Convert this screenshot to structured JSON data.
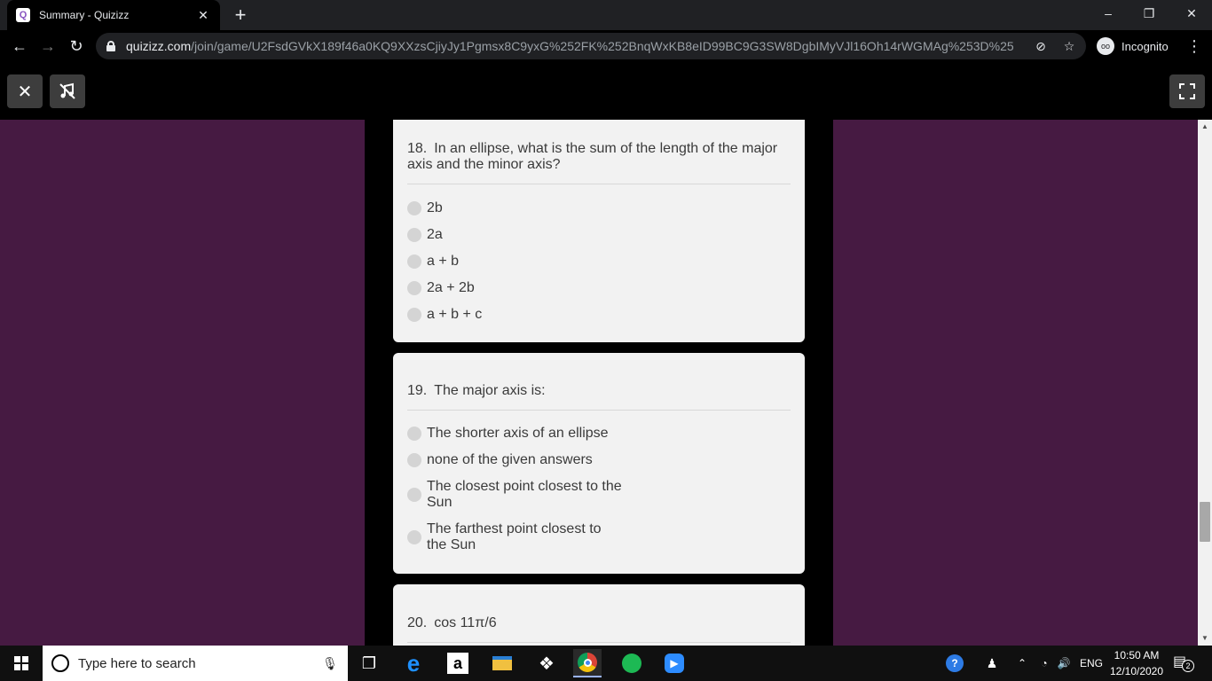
{
  "browser": {
    "tab_title": "Summary - Quizizz",
    "favicon_letter": "Q",
    "url_host": "quizizz.com",
    "url_path": "/join/game/U2FsdGVkX189f46a0KQ9XXzsCjiyJy1Pgmsx8C9yxG%252FK%252BnqWxKB8eID99BC9G3SW8DgbIMyVJl16Oh14rWGMAg%253D%253D?ga...",
    "incognito_label": "Incognito"
  },
  "questions": [
    {
      "number": "18.",
      "text": "In an ellipse, what is the sum of the length of the major axis and the minor axis?",
      "options": [
        "2b",
        "2a",
        "a + b",
        "2a + 2b",
        "a + b + c"
      ]
    },
    {
      "number": "19.",
      "text": "The major axis is:",
      "options": [
        "The shorter axis of an ellipse",
        "none of the given answers",
        "The closest point closest to the Sun",
        "The farthest point closest to the Sun"
      ]
    },
    {
      "number": "20.",
      "text": "cos 11π/6",
      "options": []
    }
  ],
  "taskbar": {
    "search_placeholder": "Type here to search",
    "language": "ENG",
    "time": "10:50 AM",
    "date": "12/10/2020",
    "notification_count": "2"
  },
  "colors": {
    "background_purple": "#461a42",
    "card_bg": "#f2f2f2",
    "browser_dark": "#202124"
  }
}
